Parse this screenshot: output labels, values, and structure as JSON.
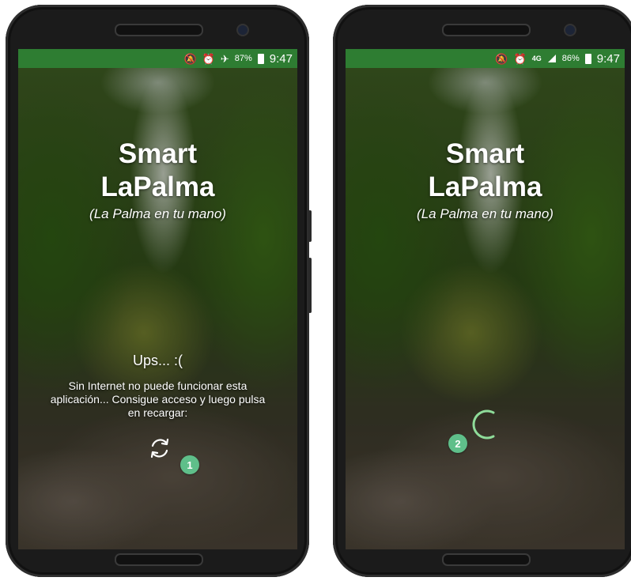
{
  "phones": [
    {
      "status": {
        "icons": [
          "mute-icon",
          "alarm-icon",
          "airplane-icon",
          "battery-icon"
        ],
        "battery_pct": "87%",
        "time": "9:47",
        "glyph_mute": "🔕",
        "glyph_alarm": "⏰",
        "glyph_airplane": "✈"
      },
      "app": {
        "title_line1": "Smart",
        "title_line2": "LaPalma",
        "subtitle": "(La Palma en tu mano)",
        "error_title": "Ups... :(",
        "error_message": "Sin Internet no puede funcionar esta aplicación... Consigue acceso y luego pulsa en recargar:"
      },
      "badge": "1"
    },
    {
      "status": {
        "icons": [
          "mute-icon",
          "alarm-icon",
          "4g-signal-icon",
          "battery-icon"
        ],
        "network": "4G",
        "battery_pct": "86%",
        "time": "9:47",
        "glyph_mute": "🔕",
        "glyph_alarm": "⏰"
      },
      "app": {
        "title_line1": "Smart",
        "title_line2": "LaPalma",
        "subtitle": "(La Palma en tu mano)"
      },
      "badge": "2"
    }
  ],
  "colors": {
    "statusbar": "#2e7d32",
    "badge": "#5fbf8a",
    "spinner": "#8fdc9a"
  }
}
